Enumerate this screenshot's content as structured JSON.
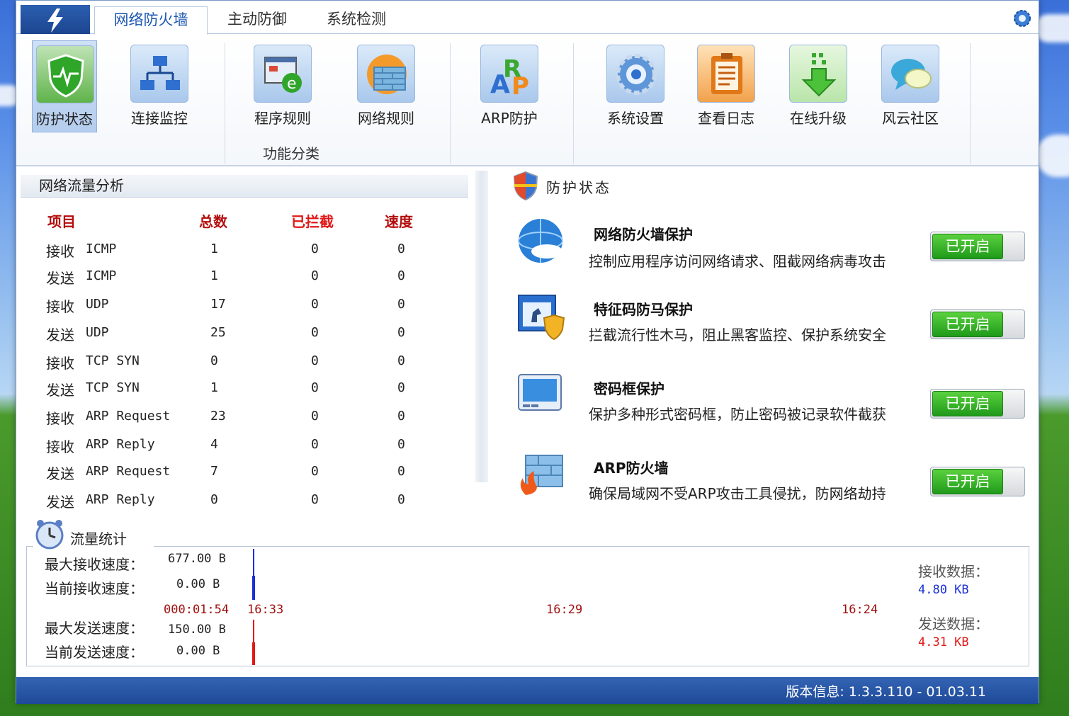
{
  "tabs": [
    {
      "label": "网络防火墙",
      "active": true
    },
    {
      "label": "主动防御",
      "active": false
    },
    {
      "label": "系统检测",
      "active": false
    }
  ],
  "ribbon": {
    "items": [
      {
        "label": "防护状态",
        "icon": "shield-icon"
      },
      {
        "label": "连接监控",
        "icon": "network-icon"
      },
      {
        "label": "程序规则",
        "icon": "program-rules-icon"
      },
      {
        "label": "网络规则",
        "icon": "firewall-globe-icon"
      },
      {
        "label": "ARP防护",
        "icon": "arp-icon"
      },
      {
        "label": "系统设置",
        "icon": "gear-icon"
      },
      {
        "label": "查看日志",
        "icon": "clipboard-icon"
      },
      {
        "label": "在线升级",
        "icon": "download-arrow-icon"
      },
      {
        "label": "风云社区",
        "icon": "chat-bubble-icon"
      }
    ],
    "group_label": "功能分类"
  },
  "traffic": {
    "title": "网络流量分析",
    "headers": {
      "item": "项目",
      "total": "总数",
      "blocked": "已拦截",
      "speed": "速度"
    },
    "rows": [
      {
        "dir": "接收",
        "type": "ICMP",
        "total": "1",
        "blocked": "0",
        "speed": "0"
      },
      {
        "dir": "发送",
        "type": "ICMP",
        "total": "1",
        "blocked": "0",
        "speed": "0"
      },
      {
        "dir": "接收",
        "type": "UDP",
        "total": "17",
        "blocked": "0",
        "speed": "0"
      },
      {
        "dir": "发送",
        "type": "UDP",
        "total": "25",
        "blocked": "0",
        "speed": "0"
      },
      {
        "dir": "接收",
        "type": "TCP SYN",
        "total": "0",
        "blocked": "0",
        "speed": "0"
      },
      {
        "dir": "发送",
        "type": "TCP SYN",
        "total": "1",
        "blocked": "0",
        "speed": "0"
      },
      {
        "dir": "接收",
        "type": "ARP Request",
        "total": "23",
        "blocked": "0",
        "speed": "0"
      },
      {
        "dir": "接收",
        "type": "ARP Reply",
        "total": "4",
        "blocked": "0",
        "speed": "0"
      },
      {
        "dir": "发送",
        "type": "ARP Request",
        "total": "7",
        "blocked": "0",
        "speed": "0"
      },
      {
        "dir": "发送",
        "type": "ARP Reply",
        "total": "0",
        "blocked": "0",
        "speed": "0"
      }
    ]
  },
  "protection": {
    "title": "防护状态",
    "items": [
      {
        "title": "网络防火墙保护",
        "desc": "控制应用程序访问网络请求、阻截网络病毒攻击",
        "status": "已开启",
        "icon": "globe-icon"
      },
      {
        "title": "特征码防马保护",
        "desc": "拦截流行性木马，阻止黑客监控、保护系统安全",
        "status": "已开启",
        "icon": "trojan-shield-icon"
      },
      {
        "title": "密码框保护",
        "desc": "保护多种形式密码框，防止密码被记录软件截获",
        "status": "已开启",
        "icon": "password-box-icon"
      },
      {
        "title": "ARP防火墙",
        "desc": "确保局域网不受ARP攻击工具侵扰，防网络劫持",
        "status": "已开启",
        "icon": "fire-wall-icon"
      }
    ]
  },
  "stats": {
    "title": "流量统计",
    "max_recv_label": "最大接收速度：",
    "max_recv_value": "677.00 B",
    "cur_recv_label": "当前接收速度：",
    "cur_recv_value": "0.00 B",
    "max_send_label": "最大发送速度：",
    "max_send_value": "150.00 B",
    "cur_send_label": "当前发送速度：",
    "cur_send_value": "0.00 B",
    "elapsed": "000:01:54",
    "times": [
      "16:33",
      "16:29",
      "16:24"
    ],
    "recv_data_label": "接收数据：",
    "recv_data_value": "4.80 KB",
    "send_data_label": "发送数据：",
    "send_data_value": "4.31 KB",
    "recv_color": "#1a2fd6",
    "send_color": "#e01818"
  },
  "status_bar": {
    "version": "版本信息: 1.3.3.110 - 01.03.11"
  }
}
